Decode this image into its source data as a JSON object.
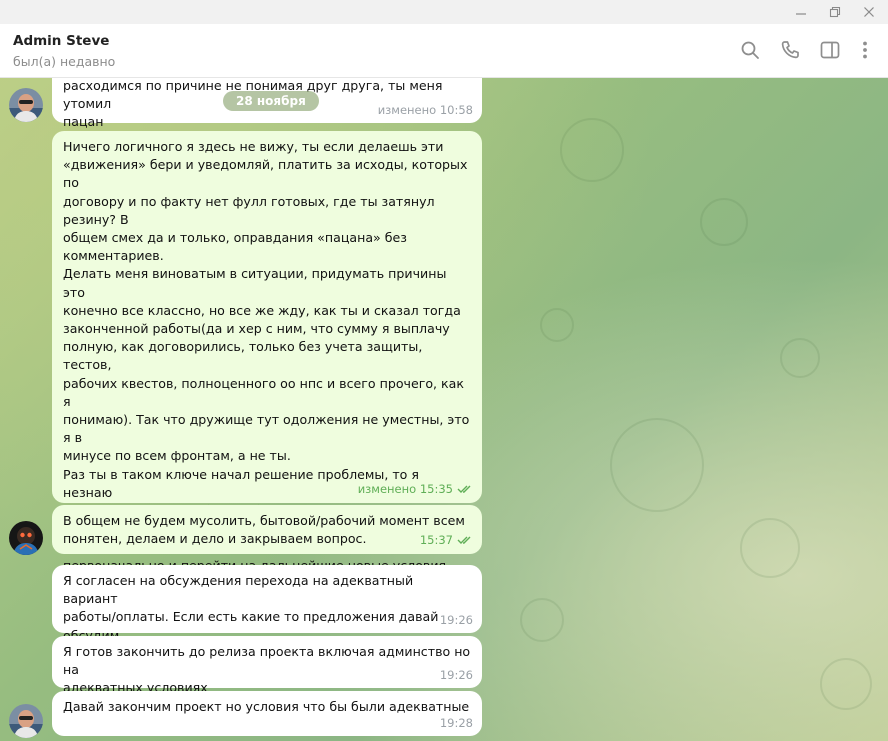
{
  "header": {
    "title": "Admin Steve",
    "status": "был(а) недавно"
  },
  "date_separator": "28 ноября",
  "messages": [
    {
      "id": "m1",
      "direction": "in",
      "text": "расходимся по причине не понимая друг друга, ты меня утомил\nпацан",
      "time": "изменено 10:58"
    },
    {
      "id": "m2",
      "direction": "out",
      "text": "Ничего логичного я здесь не вижу, ты если делаешь эти\n«движения» бери и уведомляй, платить за исходы, которых по\nдоговору и по факту нет фулл готовых, где ты затянул резину? В\nобщем смех да и только, оправдания «пацана» без\nкомментариев.\nДелать меня виноватым в ситуации, придумать причины это\nконечно все классно, но все же жду, как ты и сказал тогда\nзаконченной работы(да и хер с ним, что сумму я выплачу\nполную, как договорились, только без учета защиты, тестов,\nрабочих квестов, полноценного оо нпс и всего прочего, как я\nпонимаю). Так что дружище тут одолжения не уместны, это я в\nминусе по всем фронтам, а не ты.\nРаз ты в таком ключе начал решение проблемы, то я незнаю\nчего ты ожидал. Мы без проблем могли закончить эту стадию\nдоговоренностей, которую ты сам же обозначил\nпервоначально и перейти на дальнейшие новые условия\nработы, что было бы логично. И все были бы довольны без\nнегатива. Подготовь план работ, что осталось по твоему\nмнению - сверим и обозначь реальный срок.",
      "time": "изменено 15:35"
    },
    {
      "id": "m3",
      "direction": "out",
      "text": "В общем не будем мусолить, бытовой/рабочий момент всем\nпонятен, делаем и дело и закрываем вопрос.",
      "time": "15:37"
    },
    {
      "id": "m4",
      "direction": "in",
      "text": "Я согласен на обсуждения перехода на адекватный вариант\nработы/оплаты. Если есть какие то предложения давай обсудим.\nНо без жили были динозавры. Конкретно предложения",
      "time": "19:26"
    },
    {
      "id": "m5",
      "direction": "in",
      "text": "Я готов закончить до релиза проекта включая админство но на\nадекватных условиях",
      "time": "19:26"
    },
    {
      "id": "m6",
      "direction": "in",
      "text": "Давай закончим проект но условия что бы были адекватные",
      "time": "19:28"
    }
  ],
  "icons": {
    "header": [
      "search-icon",
      "phone-icon",
      "sidebar-toggle-icon",
      "more-vertical-icon"
    ],
    "window": [
      "minimize-icon",
      "restore-icon",
      "close-icon"
    ],
    "status": "double-check-icon"
  },
  "colors": {
    "outgoing_bubble": "#effdde",
    "incoming_bubble": "#ffffff",
    "read_ticks": "#5fae56",
    "chat_background": "#97bd80"
  }
}
